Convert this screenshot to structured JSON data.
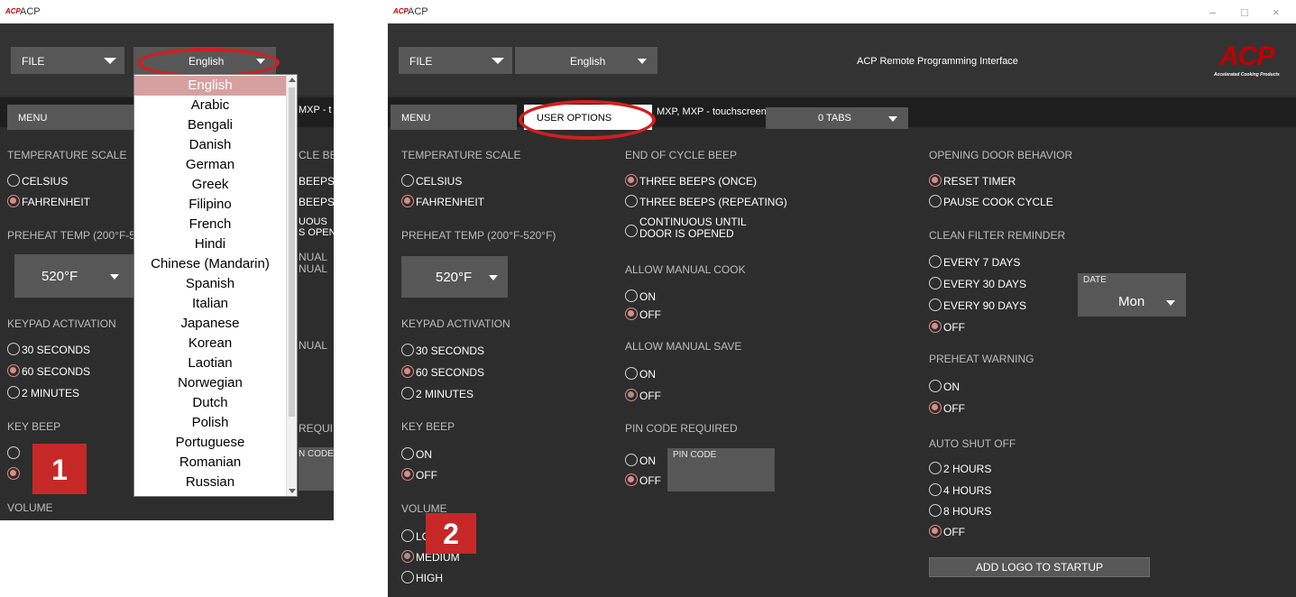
{
  "window": {
    "logo": "ACP",
    "title": "ACP",
    "controls": [
      "–",
      "□",
      "×"
    ]
  },
  "colors": {
    "accent": "#c62828",
    "radio_selected": "#d98c85",
    "panel": "#2d2d2d",
    "control": "#575757"
  },
  "toolbar": {
    "file_label": "FILE",
    "language_value": "English",
    "app_title": "ACP Remote Programming Interface",
    "brand_logo": "ACP",
    "brand_tagline": "Accelerated Cooking Products"
  },
  "tabs": {
    "menu_label": "MENU",
    "user_options_label": "USER OPTIONS",
    "model_label": "MXP, MXP - touchscreen",
    "tabs_dropdown": "0 TABS"
  },
  "left_col": {
    "temperature_scale": {
      "title": "TEMPERATURE SCALE",
      "options": [
        "CELSIUS",
        "FAHRENHEIT"
      ],
      "selected": "FAHRENHEIT"
    },
    "preheat_temp": {
      "title": "PREHEAT TEMP (200°F-520°F)",
      "value": "520°F"
    },
    "keypad_activation": {
      "title": "KEYPAD ACTIVATION",
      "options": [
        "30 SECONDS",
        "60 SECONDS",
        "2 MINUTES"
      ],
      "selected": "60 SECONDS"
    },
    "key_beep": {
      "title": "KEY BEEP",
      "options": [
        "ON",
        "OFF"
      ],
      "selected": "OFF"
    },
    "volume": {
      "title": "VOLUME",
      "options": [
        "LOW",
        "MEDIUM",
        "HIGH"
      ],
      "selected": "MEDIUM"
    }
  },
  "mid_col": {
    "end_of_cycle_beep": {
      "title": "END OF CYCLE BEEP",
      "options": [
        "THREE BEEPS (ONCE)",
        "THREE BEEPS (REPEATING)",
        "CONTINUOUS UNTIL",
        "DOOR IS OPENED"
      ],
      "selected": "THREE BEEPS (ONCE)"
    },
    "allow_manual_cook": {
      "title": "ALLOW MANUAL COOK",
      "options": [
        "ON",
        "OFF"
      ],
      "selected": "OFF"
    },
    "allow_manual_save": {
      "title": "ALLOW MANUAL SAVE",
      "options": [
        "ON",
        "OFF"
      ],
      "selected": "OFF"
    },
    "pin_code_required": {
      "title": "PIN CODE REQUIRED",
      "options": [
        "ON",
        "OFF"
      ],
      "selected": "OFF",
      "pin_code_label": "PIN CODE"
    }
  },
  "right_col": {
    "opening_door_behavior": {
      "title": "OPENING DOOR BEHAVIOR",
      "options": [
        "RESET TIMER",
        "PAUSE COOK CYCLE"
      ],
      "selected": "RESET TIMER"
    },
    "clean_filter_reminder": {
      "title": "CLEAN FILTER REMINDER",
      "options": [
        "EVERY 7 DAYS",
        "EVERY 30 DAYS",
        "EVERY 90 DAYS",
        "OFF"
      ],
      "selected": "OFF",
      "date_label": "DATE",
      "date_value": "Mon"
    },
    "preheat_warning": {
      "title": "PREHEAT WARNING",
      "options": [
        "ON",
        "OFF"
      ],
      "selected": "OFF"
    },
    "auto_shut_off": {
      "title": "AUTO SHUT OFF",
      "options": [
        "2 HOURS",
        "4 HOURS",
        "8 HOURS",
        "OFF"
      ],
      "selected": "OFF"
    },
    "add_logo_button": "ADD LOGO TO STARTUP"
  },
  "language_list": {
    "items": [
      "English",
      "Arabic",
      "Bengali",
      "Danish",
      "German",
      "Greek",
      "Filipino",
      "French",
      "Hindi",
      "Chinese (Mandarin)",
      "Spanish",
      "Italian",
      "Japanese",
      "Korean",
      "Laotian",
      "Norwegian",
      "Dutch",
      "Polish",
      "Portuguese",
      "Romanian",
      "Russian"
    ],
    "selected": "English"
  },
  "left_partial": {
    "tab_fragment": "MXP - t",
    "cycle_fragment": "CLE BE",
    "beeps_1": "BEEPS",
    "beeps_2": "BEEPS",
    "continuous_1": "UOUS",
    "continuous_2": "S OPEN",
    "manual_1": "NUAL",
    "manual_2": "NUAL",
    "manual_3": "NUAL",
    "required": "REQUI",
    "pin_code": "N CODE"
  },
  "steps": {
    "one": "1",
    "two": "2"
  }
}
